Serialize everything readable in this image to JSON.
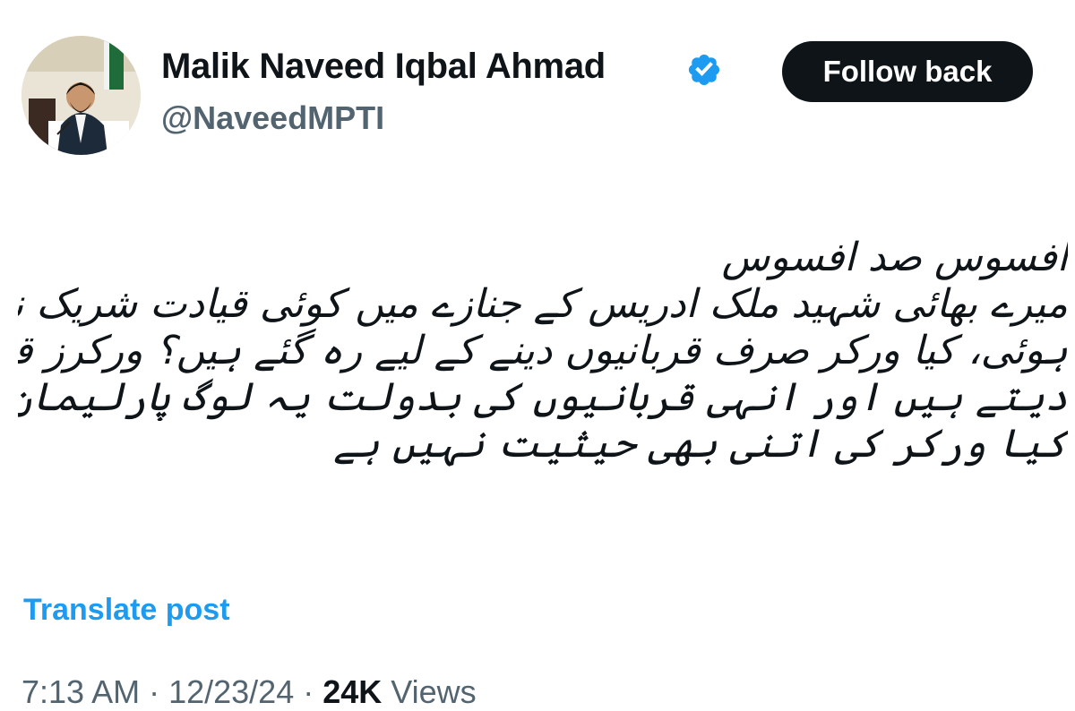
{
  "author": {
    "display_name": "Malik Naveed Iqbal Ahmad",
    "handle": "@NaveedMPTI",
    "verified_icon": "verified-badge-icon",
    "avatar_icon": "profile-photo"
  },
  "actions": {
    "follow_back_label": "Follow back"
  },
  "post": {
    "lines": [
      "افسوس صد افسوس",
      "میرے بھائی شہید ملک ادریس کے جنازے میں کوئی قیادت شریک نہیں",
      "ہوئی، کیا ورکر صرف قربانیوں دینے کے لیے رہ گئے ہیں؟ ورکرز قربانیاں",
      "دیتے ہیں اور انہی قربانیوں کی بدولت یہ لوگ پارلیمان تک پہنچتے ہیں۔",
      "کیا ورکر کی اتنی بھی حیثیت نہیں ہے"
    ],
    "translate_label": "Translate post"
  },
  "meta": {
    "time": "7:13 AM",
    "separator": " · ",
    "date": "12/23/24",
    "views_count": "24K",
    "views_label": " Views"
  },
  "colors": {
    "accent": "#1d9bf0",
    "text": "#0f1419",
    "secondary": "#536471",
    "button_bg": "#0f1419"
  }
}
